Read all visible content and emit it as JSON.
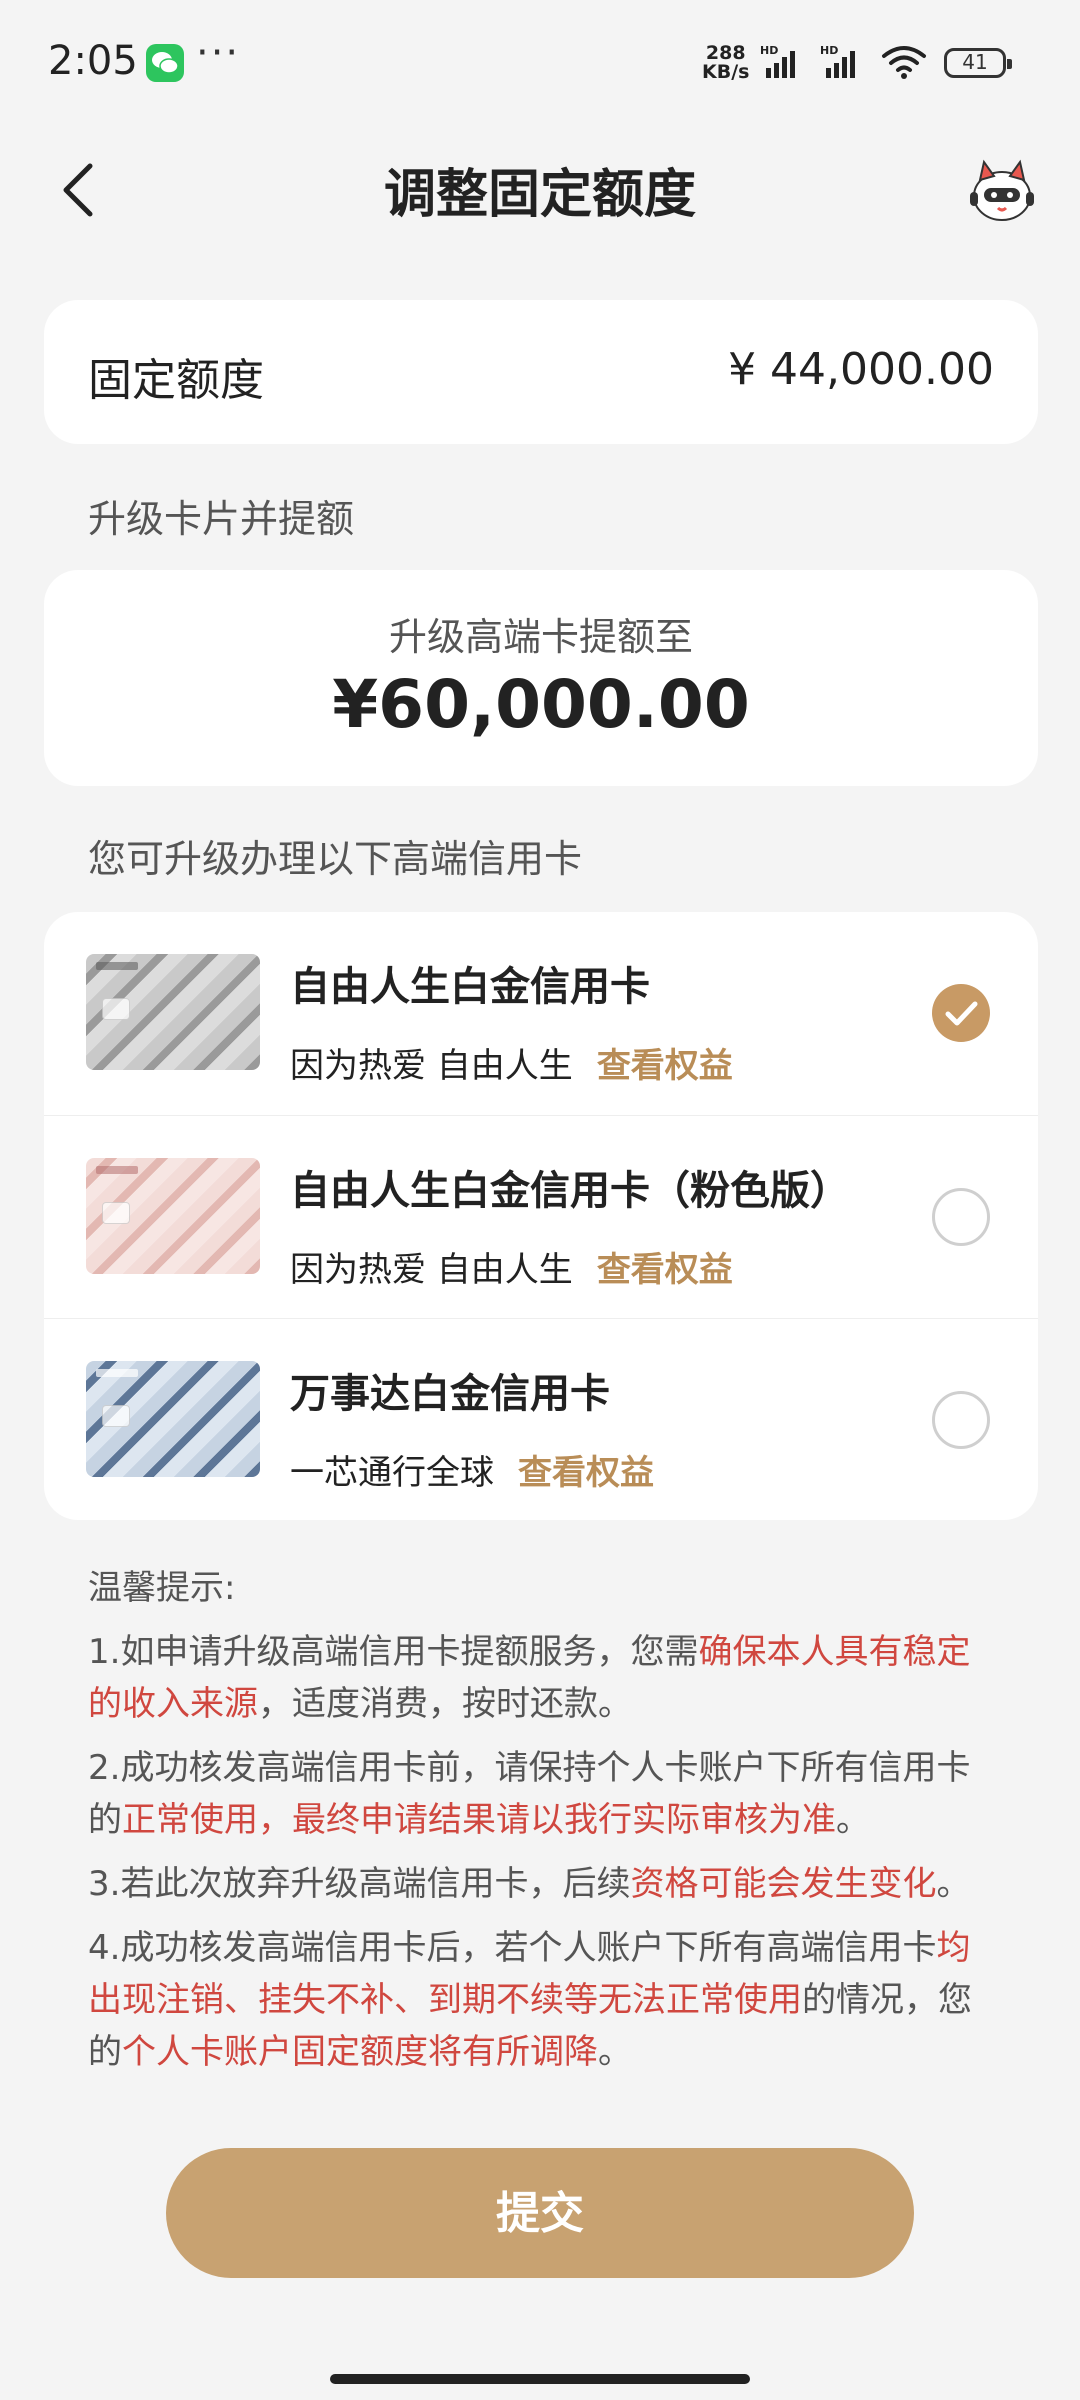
{
  "status_bar": {
    "time": "2:05",
    "more": "···",
    "net_speed_value": "288",
    "net_speed_unit": "KB/s",
    "signal_label": "HD",
    "battery": "41",
    "icons": [
      "wechat-icon",
      "signal-icon",
      "wifi-icon",
      "battery-icon"
    ]
  },
  "header": {
    "title": "调整固定额度",
    "back_icon": "chevron-left-icon",
    "assistant_icon": "mascot-icon"
  },
  "fixed_limit": {
    "label": "固定额度",
    "value": "¥ 44,000.00"
  },
  "upgrade_section": {
    "label": "升级卡片并提额",
    "subtitle": "升级高端卡提额至",
    "amount": "¥60,000.00"
  },
  "cards_section": {
    "label": "您可升级办理以下高端信用卡",
    "cards": [
      {
        "name": "自由人生白金信用卡",
        "desc": "因为热爱 自由人生",
        "link": "查看权益",
        "selected": true,
        "style": "silver"
      },
      {
        "name": "自由人生白金信用卡（粉色版）",
        "desc": "因为热爱 自由人生",
        "link": "查看权益",
        "selected": false,
        "style": "pink"
      },
      {
        "name": "万事达白金信用卡",
        "desc": "一芯通行全球",
        "link": "查看权益",
        "selected": false,
        "style": "blue"
      }
    ]
  },
  "tips": {
    "title": "温馨提示:",
    "t1_a": "1.如申请升级高端信用卡提额服务，您需",
    "t1_b": "确保本人具有稳定的收入来源",
    "t1_c": "，适度消费，按时还款。",
    "t2_a": "2.成功核发高端信用卡前，请保持个人卡账户下所有信用卡的",
    "t2_b": "正常使用，最终申请结果请以我行实际审核为准",
    "t2_c": "。",
    "t3_a": "3.若此次放弃升级高端信用卡，后续",
    "t3_b": "资格可能会发生变化",
    "t3_c": "。",
    "t4_a": "4.成功核发高端信用卡后，若个人账户下所有高端信用卡",
    "t4_b": "均出现注销、挂失不补、到期不续等无法正常使用",
    "t4_c": "的情况，您的",
    "t4_d": "个人卡账户固定额度将有所调降",
    "t4_e": "。"
  },
  "submit_label": "提交",
  "colors": {
    "accent": "#c8a271",
    "link": "#b98d57",
    "warning_text": "#d0473f",
    "background": "#f4f4f4"
  }
}
